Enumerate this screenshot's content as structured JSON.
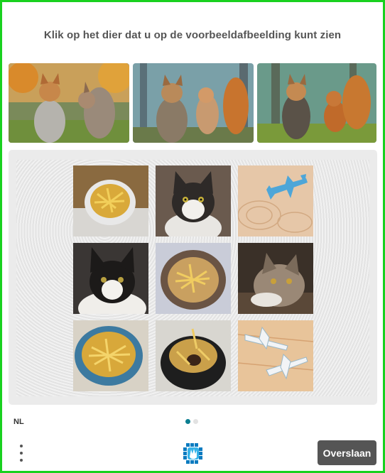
{
  "prompt": {
    "title": "Klik op het dier dat u op de voorbeeldafbeelding kunt zien"
  },
  "examples": [
    {
      "name": "example-image-cat-squirrel-autumn"
    },
    {
      "name": "example-image-cat-squirrel-forest"
    },
    {
      "name": "example-image-cat-squirrel-woods"
    }
  ],
  "grid": [
    {
      "name": "tile-fries-bowl-1",
      "subject": "fries"
    },
    {
      "name": "tile-cat-1",
      "subject": "cat"
    },
    {
      "name": "tile-airplane-1",
      "subject": "airplane"
    },
    {
      "name": "tile-cat-2",
      "subject": "cat"
    },
    {
      "name": "tile-fries-bowl-2",
      "subject": "fries"
    },
    {
      "name": "tile-cat-3",
      "subject": "cat"
    },
    {
      "name": "tile-fries-bowl-3",
      "subject": "fries"
    },
    {
      "name": "tile-fries-bowl-4",
      "subject": "fries"
    },
    {
      "name": "tile-airplane-2",
      "subject": "airplane"
    }
  ],
  "footer": {
    "language": "NL",
    "pagination": {
      "current": 1,
      "total": 2
    },
    "skip_label": "Overslaan"
  },
  "colors": {
    "frame_border": "#19d11f",
    "accent": "#0b7e91",
    "skip_button": "#555555",
    "title_text": "#555555"
  }
}
